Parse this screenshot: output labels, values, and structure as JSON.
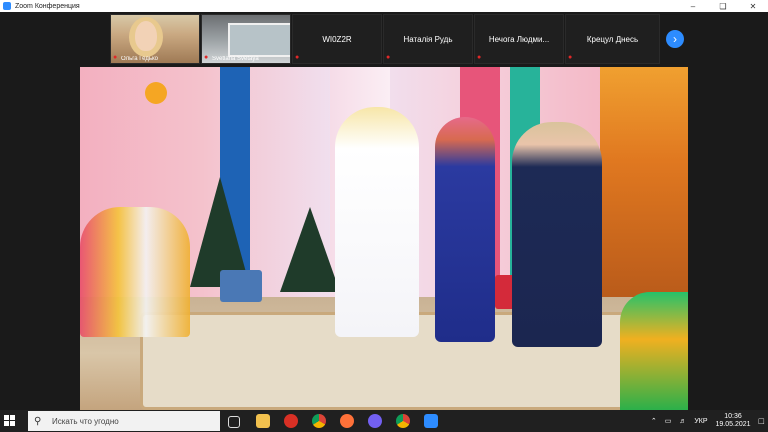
{
  "window": {
    "title": "Zoom Конференция"
  },
  "participants": [
    {
      "name": "Ольга Гедько",
      "mic_muted": true,
      "has_video": true
    },
    {
      "name": "Svetlana Svetaya",
      "mic_muted": true,
      "has_video": true
    },
    {
      "name": "WI0Z2R",
      "mic_muted": true,
      "has_video": false
    },
    {
      "name": "Наталія Рудь",
      "mic_muted": true,
      "has_video": false
    },
    {
      "name": "Нечога  Людми...",
      "mic_muted": true,
      "has_video": false
    },
    {
      "name": "Крецул Днесь",
      "mic_muted": true,
      "has_video": false
    }
  ],
  "taskbar": {
    "search_placeholder": "Искать что угодно",
    "language": "УКР",
    "time": "10:36",
    "date": "19.05.2021"
  },
  "colors": {
    "accent": "#2d8cff",
    "muted_mic": "#e02828"
  }
}
